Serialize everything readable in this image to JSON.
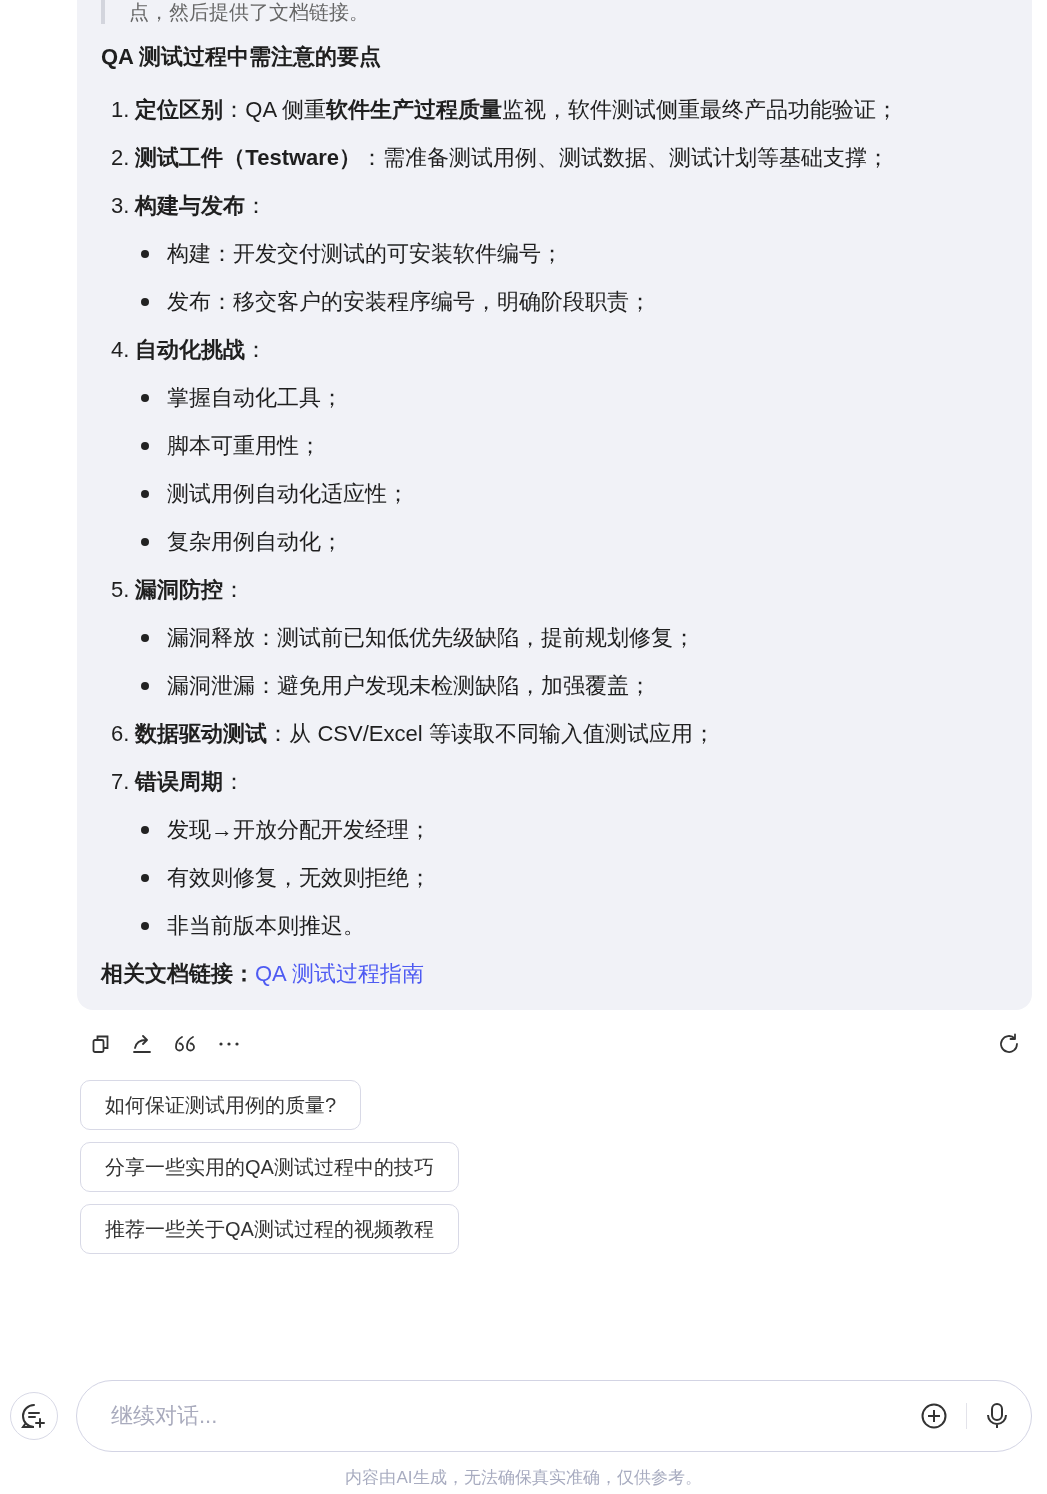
{
  "quote": {
    "text": "点，然后提供了文档链接。"
  },
  "heading": "QA 测试过程中需注意的要点",
  "items": [
    {
      "number": "1.",
      "text": "**定位区别**：QA 侧重**软件生产过程质量**监视，软件测试侧重最终产品功能验证；"
    },
    {
      "number": "2.",
      "text": "**测试工件（Testware）**：需准备测试用例、测试数据、测试计划等基础支撑；"
    },
    {
      "number": "3.",
      "text": "**构建与发布**：",
      "children": [
        {
          "text": "构建：开发交付测试的可安装软件编号；"
        },
        {
          "text": "发布：移交客户的安装程序编号，明确阶段职责；"
        }
      ]
    },
    {
      "number": "4.",
      "text": "**自动化挑战**：",
      "children": [
        {
          "text": "掌握自动化工具；"
        },
        {
          "text": "脚本可重用性；"
        },
        {
          "text": "测试用例自动化适应性；"
        },
        {
          "text": "复杂用例自动化；"
        }
      ]
    },
    {
      "number": "5.",
      "text": "**漏洞防控**：",
      "children": [
        {
          "text": "漏洞释放：测试前已知低优先级缺陷，提前规划修复；"
        },
        {
          "text": "漏洞泄漏：避免用户发现未检测缺陷，加强覆盖；"
        }
      ]
    },
    {
      "number": "6.",
      "text": "**数据驱动测试**：从 CSV/Excel 等读取不同输入值测试应用；"
    },
    {
      "number": "7.",
      "text": "**错误周期**：",
      "children": [
        {
          "text": "发现→开放分配开发经理；"
        },
        {
          "text": "有效则修复，无效则拒绝；"
        },
        {
          "text": "非当前版本则推迟。"
        }
      ]
    }
  ],
  "related": {
    "label": "相关文档链接：",
    "link": "QA 测试过程指南"
  },
  "suggestions": [
    "如何保证测试用例的质量?",
    "分享一些实用的QA测试过程中的技巧",
    "推荐一些关于QA测试过程的视频教程"
  ],
  "input": {
    "placeholder": "继续对话..."
  },
  "disclaimer": "内容由AI生成，无法确保真实准确，仅供参考。"
}
